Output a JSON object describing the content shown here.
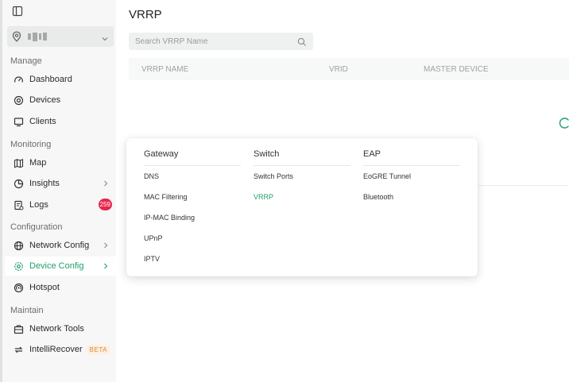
{
  "sidebar": {
    "groups": {
      "manage": "Manage",
      "monitoring": "Monitoring",
      "configuration": "Configuration",
      "maintain": "Maintain"
    },
    "items": {
      "dashboard": "Dashboard",
      "devices": "Devices",
      "clients": "Clients",
      "map": "Map",
      "insights": "Insights",
      "logs": "Logs",
      "logs_badge": "259",
      "network_config": "Network Config",
      "device_config": "Device Config",
      "hotspot": "Hotspot",
      "network_tools": "Network Tools",
      "intellirecover": "IntelliRecover",
      "beta": "BETA"
    }
  },
  "main": {
    "title": "VRRP",
    "search_placeholder": "Search VRRP Name",
    "columns": [
      "VRRP NAME",
      "VRID",
      "MASTER DEVICE"
    ]
  },
  "menu": {
    "gateway": {
      "title": "Gateway",
      "items": [
        "DNS",
        "MAC Filtering",
        "IP-MAC Binding",
        "UPnP",
        "IPTV"
      ]
    },
    "switch": {
      "title": "Switch",
      "items": [
        "Switch Ports",
        "VRRP"
      ]
    },
    "eap": {
      "title": "EAP",
      "items": [
        "EoGRE Tunnel",
        "Bluetooth"
      ]
    }
  },
  "colors": {
    "accent": "#1f9e6a",
    "badge": "#e5274d",
    "sidebar_bg": "#f6f7f6"
  }
}
